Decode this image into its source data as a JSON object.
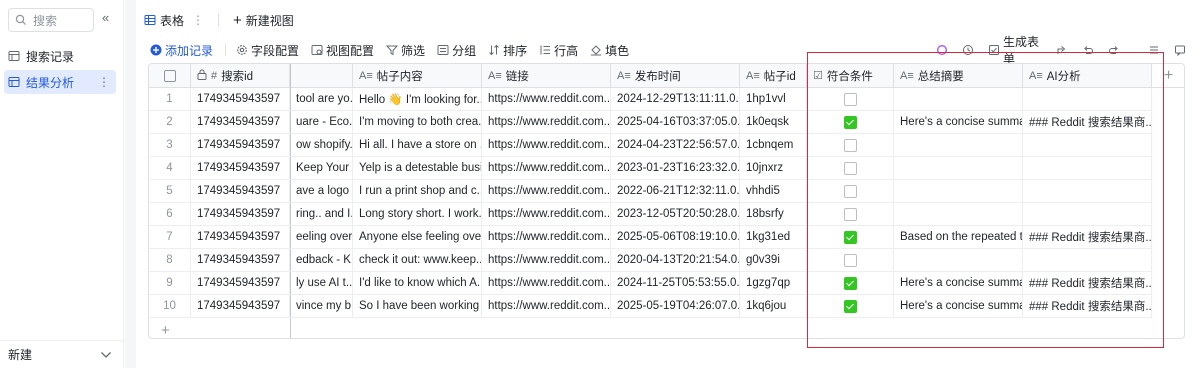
{
  "sidebar": {
    "search_placeholder": "搜索",
    "collapse_icon": "«",
    "items": [
      {
        "label": "搜索记录",
        "icon": "table-icon",
        "active": false
      },
      {
        "label": "结果分析",
        "icon": "table-icon",
        "active": true
      }
    ],
    "more_icon": "⋮",
    "footer_label": "新建",
    "footer_chevron": "⌄"
  },
  "tabs": {
    "active_label": "表格",
    "kebab": "⋮",
    "new_view_label": "新建视图",
    "plus": "+"
  },
  "toolbar": {
    "add_record": "添加记录",
    "field_config": "字段配置",
    "view_config": "视图配置",
    "filter": "筛选",
    "group": "分组",
    "sort": "排序",
    "row_height": "行高",
    "fill_color": "填色",
    "generate_form": "生成表单"
  },
  "grid": {
    "columns": [
      {
        "key": "search_id",
        "label": "搜索id",
        "icon": "#"
      },
      {
        "key": "title",
        "label": "",
        "icon": ""
      },
      {
        "key": "content",
        "label": "帖子内容",
        "icon": "A≡"
      },
      {
        "key": "link",
        "label": "链接",
        "icon": "A≡"
      },
      {
        "key": "time",
        "label": "发布时间",
        "icon": "A≡"
      },
      {
        "key": "post_id",
        "label": "帖子id",
        "icon": "A≡"
      },
      {
        "key": "match",
        "label": "符合条件",
        "icon": "☑"
      },
      {
        "key": "summary",
        "label": "总结摘要",
        "icon": "A≡"
      },
      {
        "key": "ai",
        "label": "AI分析",
        "icon": "A≡"
      }
    ],
    "rows": [
      {
        "n": "1",
        "search_id": "1749345943597",
        "title": "tool are yo...",
        "content": "Hello 👋 I'm looking for...",
        "link": "https://www.reddit.com...",
        "time": "2024-12-29T13:11:11.0...",
        "post_id": "1hp1vvl",
        "match": false,
        "summary": "",
        "ai": ""
      },
      {
        "n": "2",
        "search_id": "1749345943597",
        "title": "uare - Eco...",
        "content": "I'm moving to both crea...",
        "link": "https://www.reddit.com...",
        "time": "2025-04-16T03:37:05.0...",
        "post_id": "1k0eqsk",
        "match": true,
        "summary": "Here's a concise summa...",
        "ai": "### Reddit 搜索结果商..."
      },
      {
        "n": "3",
        "search_id": "1749345943597",
        "title": "ow shopify...",
        "content": "Hi all. I have a store on ...",
        "link": "https://www.reddit.com...",
        "time": "2024-04-23T22:56:57.0...",
        "post_id": "1cbnqem",
        "match": false,
        "summary": "",
        "ai": ""
      },
      {
        "n": "4",
        "search_id": "1749345943597",
        "title": "Keep Your ...",
        "content": "Yelp is a detestable busi...",
        "link": "https://www.reddit.com...",
        "time": "2023-01-23T16:23:32.0...",
        "post_id": "10jnxrz",
        "match": false,
        "summary": "",
        "ai": ""
      },
      {
        "n": "5",
        "search_id": "1749345943597",
        "title": "ave a logo ...",
        "content": "I run a print shop and c...",
        "link": "https://www.reddit.com...",
        "time": "2022-06-21T12:32:11.0...",
        "post_id": "vhhdi5",
        "match": false,
        "summary": "",
        "ai": ""
      },
      {
        "n": "6",
        "search_id": "1749345943597",
        "title": "ring.. and I...",
        "content": "Long story short. I work...",
        "link": "https://www.reddit.com...",
        "time": "2023-12-05T20:50:28.0...",
        "post_id": "18bsrfy",
        "match": false,
        "summary": "",
        "ai": ""
      },
      {
        "n": "7",
        "search_id": "1749345943597",
        "title": "eeling over...",
        "content": "Anyone else feeling over...",
        "link": "https://www.reddit.com...",
        "time": "2025-05-06T08:19:10.0...",
        "post_id": "1kg31ed",
        "match": true,
        "summary": "Based on the repeated t...",
        "ai": "### Reddit 搜索结果商..."
      },
      {
        "n": "8",
        "search_id": "1749345943597",
        "title": "edback - K...",
        "content": "check it out: www.keep...",
        "link": "https://www.reddit.com...",
        "time": "2020-04-13T20:21:54.0...",
        "post_id": "g0v39i",
        "match": false,
        "summary": "",
        "ai": ""
      },
      {
        "n": "9",
        "search_id": "1749345943597",
        "title": "ly use AI t...",
        "content": "I'd like to know which A...",
        "link": "https://www.reddit.com...",
        "time": "2024-11-25T05:53:55.0...",
        "post_id": "1gzg7qp",
        "match": true,
        "summary": "Here's a concise summa...",
        "ai": "### Reddit 搜索结果商..."
      },
      {
        "n": "10",
        "search_id": "1749345943597",
        "title": "vince my b...",
        "content": "So I have been working ...",
        "link": "https://www.reddit.com...",
        "time": "2025-05-19T04:26:07.0...",
        "post_id": "1kq6jou",
        "match": true,
        "summary": "Here's a concise summa...",
        "ai": "### Reddit 搜索结果商..."
      }
    ],
    "add_column": "+",
    "add_row": "+"
  },
  "colors": {
    "accent": "#245bdb",
    "check_green": "#34c724",
    "highlight_red": "#d9283a"
  }
}
